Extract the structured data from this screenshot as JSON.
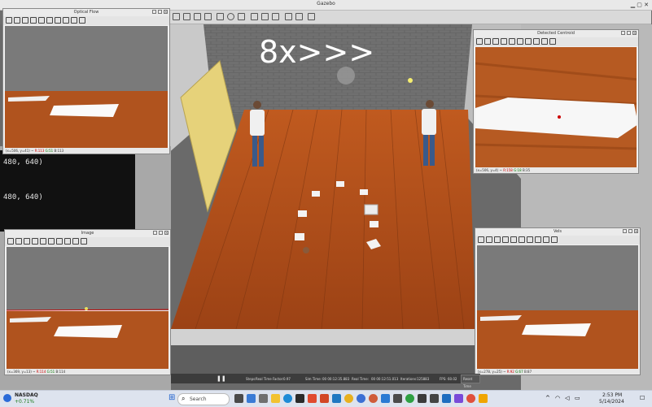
{
  "app": {
    "title": "Gazebo"
  },
  "overlay": {
    "speed": "8x>>>"
  },
  "terminal": {
    "lines": [
      "480, 640)",
      "480, 640)"
    ]
  },
  "windows": {
    "optical_flow": {
      "title": "Optical Flow",
      "status_coords": "(x=506, y=41) ~",
      "status_r": "R:113",
      "status_g": "G:51",
      "status_b": "B:113"
    },
    "centroid": {
      "title": "Detected Centroid",
      "status_coords": "(x=506, y=4) ~",
      "status_r": "R:158",
      "status_g": "G:18",
      "status_b": "B:35"
    },
    "image": {
      "title": "Image",
      "status_coords": "(x=369, y=13) ~",
      "status_r": "R:114",
      "status_g": "G:51",
      "status_b": "B:114"
    },
    "vels": {
      "title": "Vels",
      "status_coords": "(x=278, y=25) ~",
      "status_r": "R:92",
      "status_g": "G:67",
      "status_b": "B:87"
    }
  },
  "playbar": {
    "steps_label": "Steps:",
    "rtf_label": "Real Time Factor:",
    "rtf_value": "0.97",
    "sim_time_label": "Sim Time:",
    "sim_time": "00 00:12:35.883",
    "real_time_label": "Real Time:",
    "real_time": "00 00:12:51.013",
    "iter_label": "Iterations:",
    "iterations": "125883",
    "fps_label": "FPS:",
    "fps": "60.02",
    "reset_label": "Reset Time"
  },
  "taskbar": {
    "ticker_name": "NASDAQ",
    "ticker_change": "+0.71%",
    "search_placeholder": "Search",
    "time": "2:53 PM",
    "date": "5/14/2024"
  },
  "colors": {
    "floor": "#b5501e",
    "accent_red": "#cc0000"
  }
}
